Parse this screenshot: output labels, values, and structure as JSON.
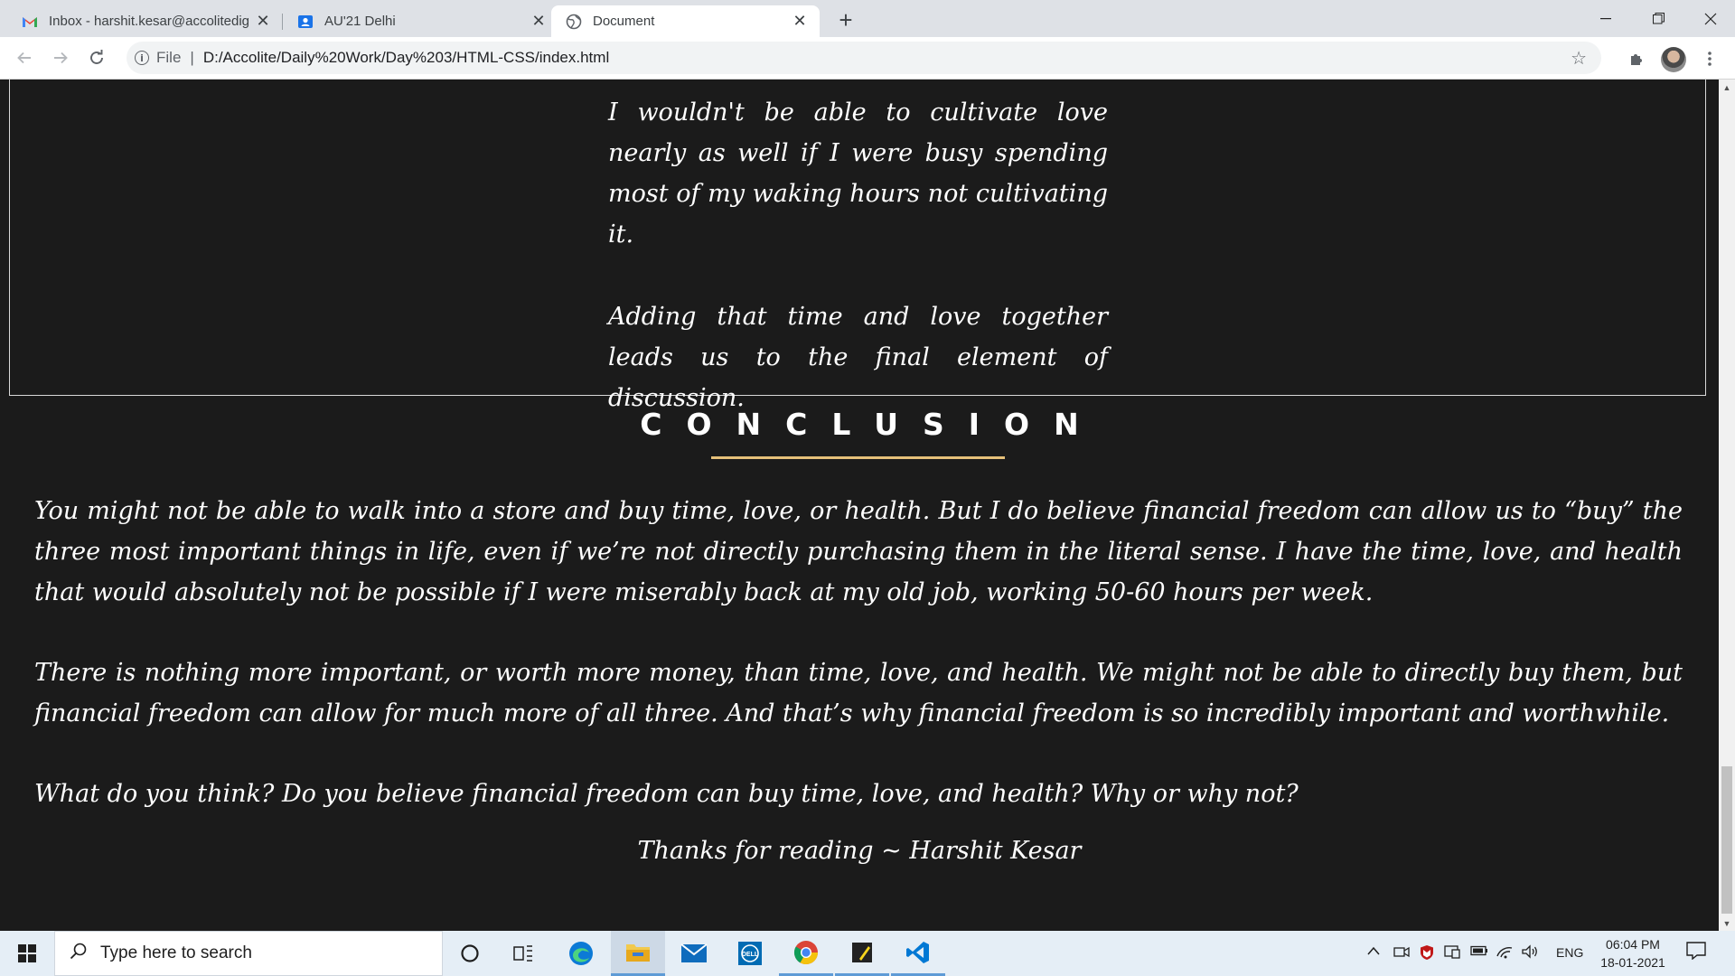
{
  "browser": {
    "tabs": [
      {
        "title": "Inbox - harshit.kesar@accolitedigital.com",
        "icon": "gmail-icon"
      },
      {
        "title": "AU'21 Delhi",
        "icon": "contacts-icon"
      },
      {
        "title": "Document",
        "icon": "globe-icon"
      }
    ],
    "address": {
      "scheme_label": "File",
      "url": "D:/Accolite/Daily%20Work/Day%203/HTML-CSS/index.html"
    }
  },
  "page": {
    "quote_paragraphs": [
      "I wouldn't be able to cultivate love nearly as well if I were busy spending most of my waking hours not cultivating it.",
      "Adding that time and love together leads us to the final element of discussion."
    ],
    "conclusion_heading": "CONCLUSION",
    "conclusion_paragraphs": [
      "You might not be able to walk into a store and buy time, love, or health. But I do believe financial freedom can allow us to “buy” the three most important things in life, even if we’re not directly purchasing them in the literal sense. I have the time, love, and health that would absolutely not be possible if I were miserably back at my old job, working 50-60 hours per week.",
      "There is nothing more important, or worth more money, than time, love, and health. We might not be able to directly buy them, but financial freedom can allow for much more of all three. And that’s why financial freedom is so incredibly important and worthwhile.",
      "What do you think? Do you believe financial freedom can buy time, love, and health? Why or why not?"
    ],
    "signature": "Thanks for reading ~ Harshit Kesar",
    "accent_color": "#e6c07a",
    "background_color": "#1b1b1b"
  },
  "taskbar": {
    "search_placeholder": "Type here to search",
    "language": "ENG",
    "time": "06:04 PM",
    "date": "18-01-2021"
  }
}
